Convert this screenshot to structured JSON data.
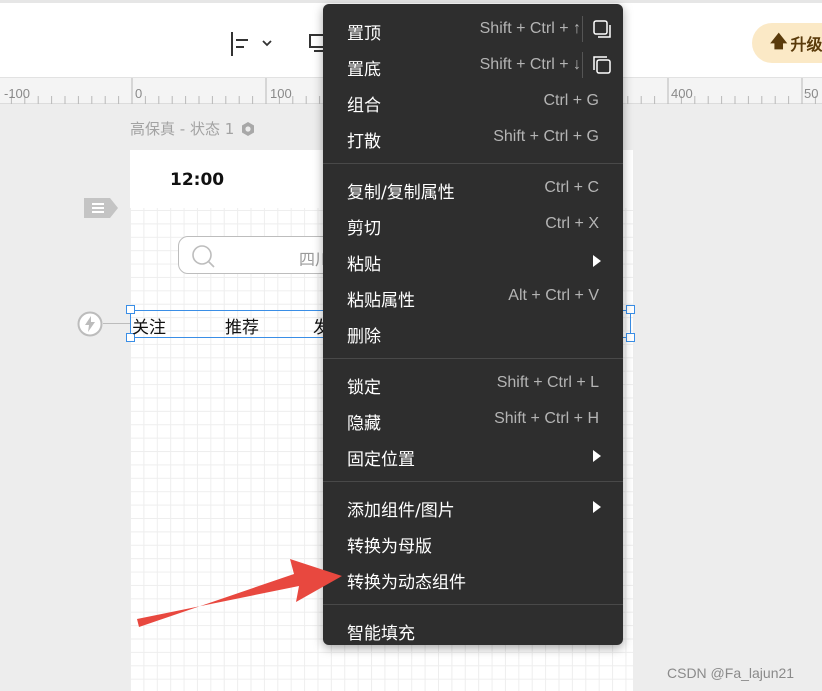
{
  "ruler": {
    "labels": [
      "-100",
      "0",
      "100",
      "400",
      "50"
    ]
  },
  "toolbar": {
    "upgrade_label": "升级"
  },
  "canvas": {
    "state_label": "高保真 - 状态 1",
    "status_time": "12:00",
    "search_text": "四川",
    "tabs": [
      "关注",
      "推荐",
      "发"
    ]
  },
  "context_menu": {
    "groups": [
      {
        "items": [
          {
            "label": "置顶",
            "shortcut": "Shift + Ctrl + ↑",
            "icon": "bring-to-front-icon"
          },
          {
            "label": "置底",
            "shortcut": "Shift + Ctrl + ↓",
            "icon": "send-to-back-icon"
          },
          {
            "label": "组合",
            "shortcut": "Ctrl + G"
          },
          {
            "label": "打散",
            "shortcut": "Shift + Ctrl + G"
          }
        ]
      },
      {
        "items": [
          {
            "label": "复制/复制属性",
            "shortcut": "Ctrl + C"
          },
          {
            "label": "剪切",
            "shortcut": "Ctrl + X"
          },
          {
            "label": "粘贴",
            "shortcut": "",
            "submenu": true
          },
          {
            "label": "粘贴属性",
            "shortcut": "Alt + Ctrl + V"
          },
          {
            "label": "删除",
            "shortcut": ""
          }
        ]
      },
      {
        "items": [
          {
            "label": "锁定",
            "shortcut": "Shift + Ctrl + L"
          },
          {
            "label": "隐藏",
            "shortcut": "Shift + Ctrl + H"
          },
          {
            "label": "固定位置",
            "shortcut": "",
            "submenu": true
          }
        ]
      },
      {
        "items": [
          {
            "label": "添加组件/图片",
            "shortcut": "",
            "submenu": true
          },
          {
            "label": "转换为母版",
            "shortcut": ""
          },
          {
            "label": "转换为动态组件",
            "shortcut": ""
          }
        ]
      },
      {
        "items": [
          {
            "label": "智能填充",
            "shortcut": ""
          }
        ]
      }
    ]
  },
  "colors": {
    "menu_bg": "#2e2e2e",
    "selection": "#3a8ee6",
    "annotation_arrow": "#e8483f",
    "upgrade_bg": "#fbe9c6"
  },
  "watermark": "CSDN @Fa_lajun21"
}
